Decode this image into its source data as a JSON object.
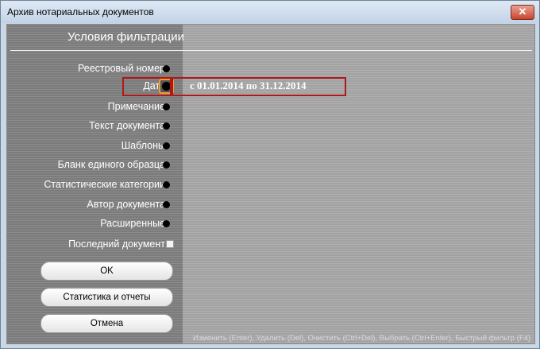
{
  "window": {
    "title": "Архив нотариальных документов",
    "close_glyph": "✕"
  },
  "panel": {
    "title": "Условия фильтрации"
  },
  "filters": [
    {
      "label": "Реестровый номер"
    },
    {
      "label": "Дата"
    },
    {
      "label": "Примечание"
    },
    {
      "label": "Текст документа"
    },
    {
      "label": "Шаблоны"
    },
    {
      "label": "Бланк единого образца"
    },
    {
      "label": "Статистические категории"
    },
    {
      "label": "Автор документа"
    },
    {
      "label": "Расширенные"
    }
  ],
  "date_filter_value": "с 01.01.2014 по 31.12.2014",
  "last_document": {
    "label": "Последний документ",
    "checked": false
  },
  "buttons": {
    "ok": "OK",
    "stats": "Статистика и отчеты",
    "cancel": "Отмена"
  },
  "statusbar": "Изменить (Enter), Удалить (Del), Очистить (Ctrl+Del), Выбрать (Ctrl+Enter), Быстрый фильтр (F4)"
}
